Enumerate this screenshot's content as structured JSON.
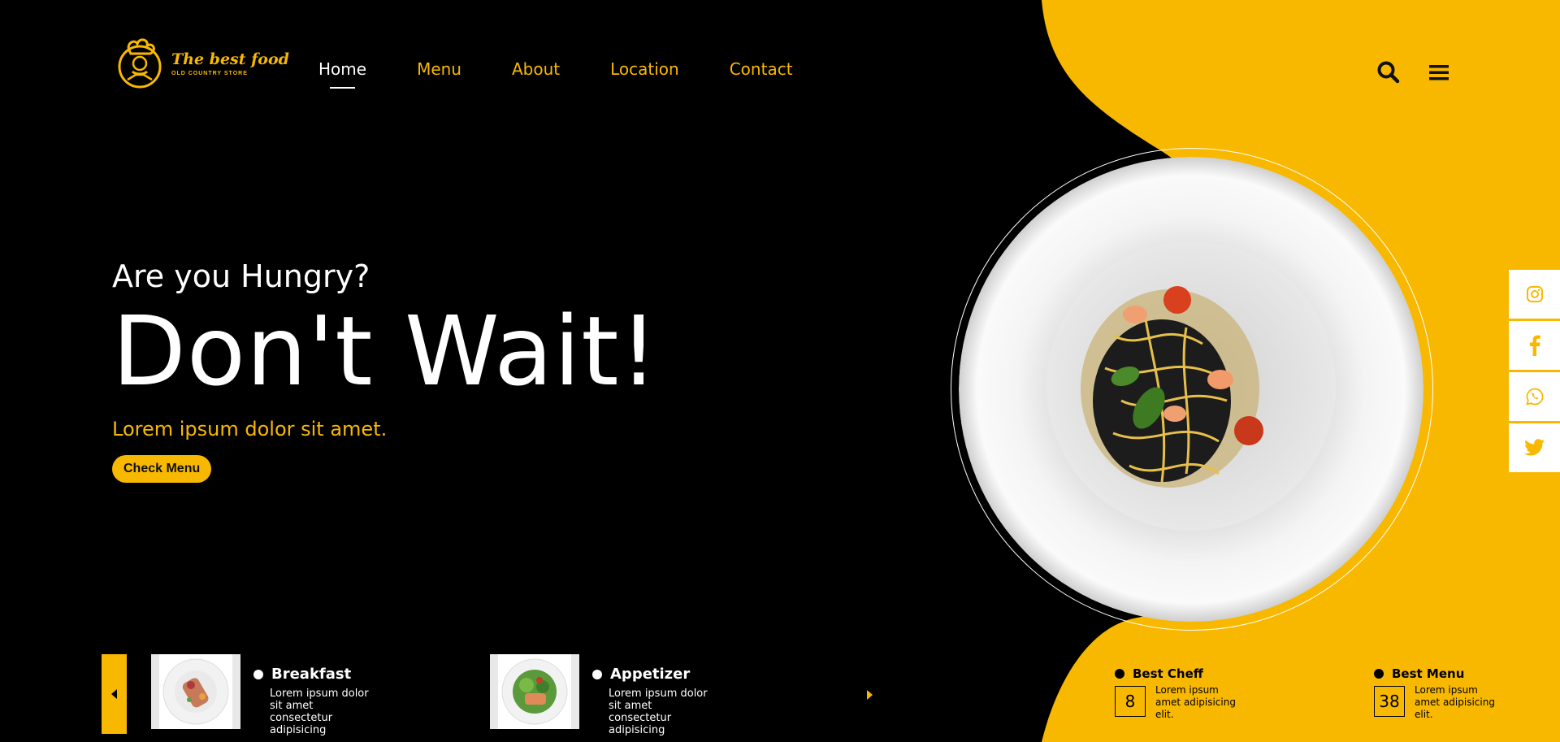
{
  "brand": {
    "title": "The best food",
    "subtitle": "OLD COUNTRY STORE"
  },
  "nav": [
    {
      "label": "Home",
      "active": true
    },
    {
      "label": "Menu"
    },
    {
      "label": "About"
    },
    {
      "label": "Location"
    },
    {
      "label": "Contact"
    }
  ],
  "header_icons": [
    "search-icon",
    "menu-icon"
  ],
  "hero": {
    "subtitle": "Are you Hungry?",
    "title": "Don't Wait!",
    "tagline": "Lorem ipsum dolor sit amet.",
    "cta": "Check Menu"
  },
  "social": [
    "instagram-icon",
    "facebook-icon",
    "whatsapp-icon",
    "twitter-icon"
  ],
  "cards": [
    {
      "title": "Breakfast",
      "desc": "Lorem ipsum dolor sit amet consectetur adipisicing"
    },
    {
      "title": "Appetizer",
      "desc": "Lorem ipsum dolor sit amet consectetur adipisicing"
    }
  ],
  "stats": [
    {
      "title": "Best Cheff",
      "number": "8",
      "desc": "Lorem ipsum amet adipisicing elit."
    },
    {
      "title": "Best Menu",
      "number": "38",
      "desc": "Lorem ipsum amet adipisicing elit."
    }
  ],
  "colors": {
    "accent": "#f9b800",
    "background": "#000000",
    "text": "#ffffff"
  }
}
